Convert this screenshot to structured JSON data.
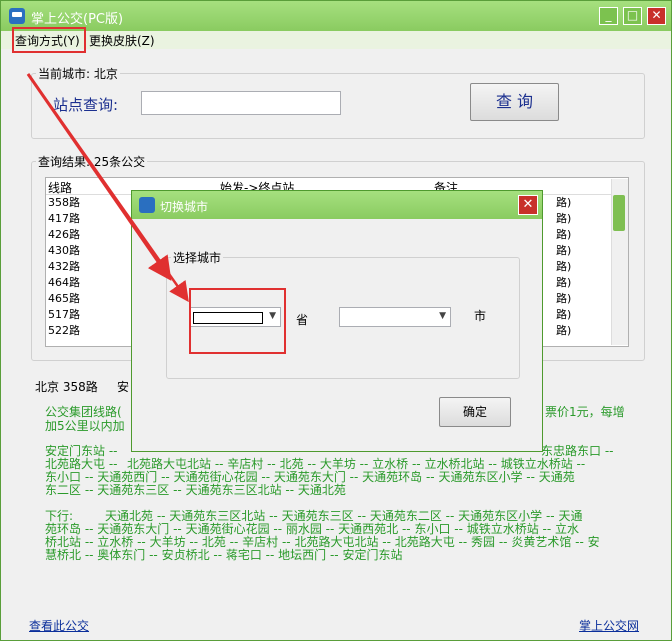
{
  "window": {
    "title": "掌上公交(PC版)",
    "minimize": "_",
    "maximize": "□",
    "close": "✕"
  },
  "menu": {
    "query_mode": "查询方式(Y)",
    "change_skin": "更换皮肤(Z)"
  },
  "current_city": {
    "legend": "当前城市: 北京",
    "station_label": "站点查询:",
    "station_value": "",
    "query_button": "查 询"
  },
  "results": {
    "legend": "查询结果: 25条公交",
    "columns": [
      "线路",
      "始发->终点站",
      "备注"
    ],
    "rows": [
      {
        "line": "358路",
        "note_tail": "路)"
      },
      {
        "line": "417路",
        "note_tail": "路)"
      },
      {
        "line": "426路",
        "note_tail": "路)"
      },
      {
        "line": "430路",
        "note_tail": "路)"
      },
      {
        "line": "432路",
        "note_tail": "路)"
      },
      {
        "line": "464路",
        "note_tail": "路)"
      },
      {
        "line": "465路",
        "note_tail": "路)"
      },
      {
        "line": "517路",
        "note_tail": "路)"
      },
      {
        "line": "522路",
        "note_tail": "路)"
      }
    ]
  },
  "detail": {
    "header_city": "北京 358路",
    "header_tail": "安",
    "line1_head": "公交集团线路(",
    "line1_tail": "票价1元，每增",
    "line2_head": "加5公里以内加",
    "up_head": "安定门东站 --",
    "up_tail": "东忠路东口 --",
    "up_l2_head": "北苑路大屯 --",
    "up_l2_tail": "北苑路大屯北站 -- 辛店村 -- 北苑 -- 大羊坊 -- 立水桥 -- 立水桥北站 -- 城铁立水桥站 --",
    "up_l3": "东小口 -- 天通苑西门 -- 天通苑街心花园 -- 天通苑东大门 -- 天通苑环岛 -- 天通苑东区小学 -- 天通苑",
    "up_l4": "东二区 -- 天通苑东三区 -- 天通苑东三区北站 -- 天通北苑",
    "down_label": "下行:",
    "down_l1": "天通北苑 -- 天通苑东三区北站 -- 天通苑东三区 -- 天通苑东二区 -- 天通苑东区小学 -- 天通",
    "down_l2": "苑环岛 -- 天通苑东大门 -- 天通苑街心花园 -- 丽水园 -- 天通西苑北 -- 东小口 -- 城铁立水桥站 -- 立水",
    "down_l3": "桥北站 -- 立水桥 -- 大羊坊 -- 北苑 -- 辛店村 -- 北苑路大屯北站 -- 北苑路大屯 -- 秀园 -- 炎黄艺术馆 -- 安",
    "down_l4": "慧桥北 -- 奥体东门 -- 安贞桥北 -- 蒋宅口 -- 地坛西门 -- 安定门东站"
  },
  "footer": {
    "view_bus": "查看此公交",
    "site": "掌上公交网"
  },
  "dialog": {
    "title": "切换城市",
    "close": "✕",
    "group_legend": "选择城市",
    "province_value": "",
    "province_unit": "省",
    "city_value": "",
    "city_unit": "市",
    "confirm": "确定"
  },
  "colors": {
    "titlebar": "#8acb60",
    "highlight": "#e03030",
    "route_text": "#2a9a2a",
    "link": "#0b2f9b"
  }
}
